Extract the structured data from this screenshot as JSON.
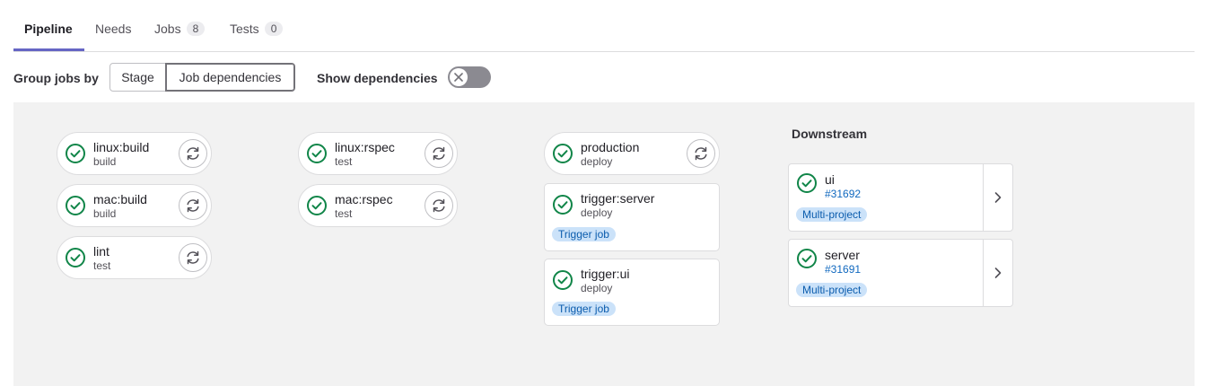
{
  "tabs": [
    {
      "label": "Pipeline",
      "count": null
    },
    {
      "label": "Needs",
      "count": null
    },
    {
      "label": "Jobs",
      "count": "8"
    },
    {
      "label": "Tests",
      "count": "0"
    }
  ],
  "toolbar": {
    "group_label": "Group jobs by",
    "stage_option": "Stage",
    "deps_option": "Job dependencies",
    "selected": "Job dependencies",
    "show_deps_label": "Show dependencies",
    "show_deps_on": false
  },
  "jobs": [
    {
      "name": "linux:build",
      "stage": "build",
      "status": "success"
    },
    {
      "name": "mac:build",
      "stage": "build",
      "status": "success"
    },
    {
      "name": "lint",
      "stage": "test",
      "status": "success"
    },
    {
      "name": "linux:rspec",
      "stage": "test",
      "status": "success"
    },
    {
      "name": "mac:rspec",
      "stage": "test",
      "status": "success"
    },
    {
      "name": "production",
      "stage": "deploy",
      "status": "success"
    },
    {
      "name": "trigger:server",
      "stage": "deploy",
      "status": "success",
      "tag": "Trigger job"
    },
    {
      "name": "trigger:ui",
      "stage": "deploy",
      "status": "success",
      "tag": "Trigger job"
    }
  ],
  "downstream": {
    "title": "Downstream",
    "pipelines": [
      {
        "name": "ui",
        "id": "#31692",
        "tag": "Multi-project",
        "status": "success"
      },
      {
        "name": "server",
        "id": "#31691",
        "tag": "Multi-project",
        "status": "success"
      }
    ]
  },
  "colors": {
    "success": "#108548",
    "tab_active": "#6666c4",
    "link": "#1068bf",
    "tag_bg": "#cbe2f9",
    "graph_bg": "#f2f2f2"
  }
}
